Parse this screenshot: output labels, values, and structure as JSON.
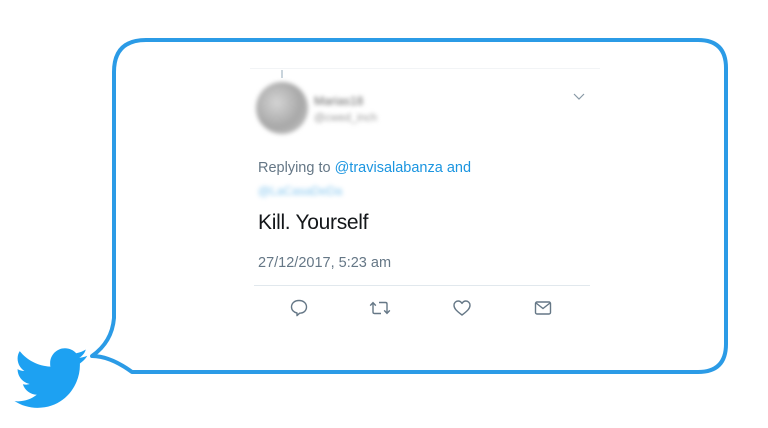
{
  "tweet": {
    "display_name": "Marias18",
    "handle": "@cwed_inch",
    "replying_prefix": "Replying to",
    "replying_mention": "@travisalabanza",
    "replying_suffix": "and",
    "extra_mention": "@LaCasaDeDa",
    "text": "Kill. Yourself",
    "timestamp": "27/12/2017, 5:23 am"
  },
  "actions": {
    "reply": "reply-icon",
    "retweet": "retweet-icon",
    "like": "heart-icon",
    "dm": "envelope-icon"
  },
  "colors": {
    "bubble_border": "#2b9be6",
    "twitter_blue": "#1da1f2",
    "mention": "#1b95e0",
    "muted_text": "#657786",
    "icon": "#657786"
  }
}
